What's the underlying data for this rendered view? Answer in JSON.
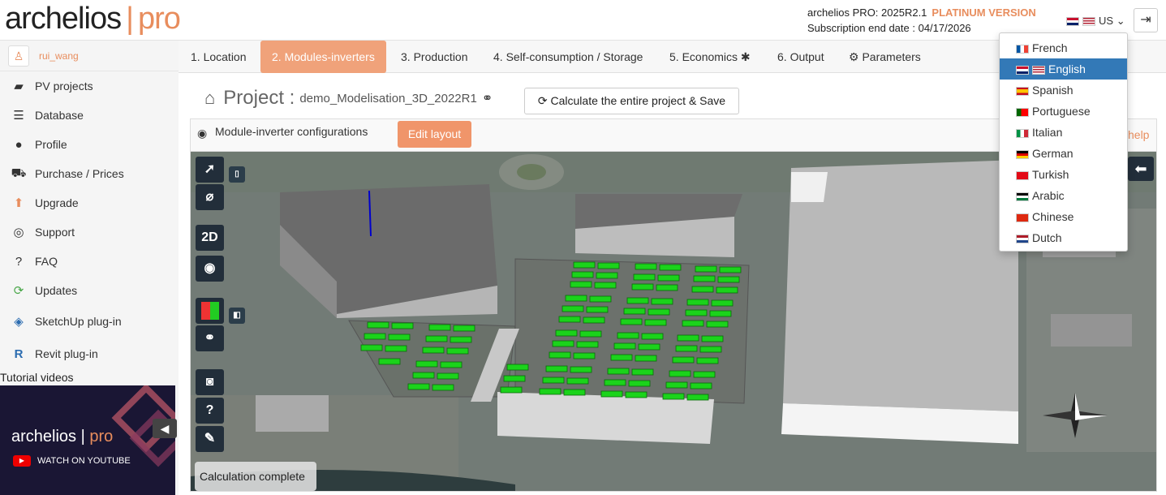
{
  "header": {
    "logo_main": "archelios",
    "logo_sep": "|",
    "logo_pro": "pro",
    "version_text": "archelios PRO: 2025R2.1",
    "edition": "PLATINUM VERSION",
    "subscription": "Subscription end date : 04/17/2026",
    "language_code": "US",
    "logout_icon": "logout-icon"
  },
  "sidebar": {
    "user": "rui_wang",
    "items": [
      {
        "label": "PV projects",
        "icon": "folder-icon"
      },
      {
        "label": "Database",
        "icon": "database-icon"
      },
      {
        "label": "Profile",
        "icon": "user-icon"
      },
      {
        "label": "Purchase / Prices",
        "icon": "cart-icon"
      },
      {
        "label": "Upgrade",
        "icon": "arrow-up-icon"
      },
      {
        "label": "Support",
        "icon": "lifebuoy-icon"
      },
      {
        "label": "FAQ",
        "icon": "question-icon"
      },
      {
        "label": "Updates",
        "icon": "refresh-icon"
      },
      {
        "label": "SketchUp plug-in",
        "icon": "sketchup-icon"
      },
      {
        "label": "Revit plug-in",
        "icon": "revit-icon"
      }
    ],
    "tutorial_label": "Tutorial videos",
    "video_logo_main": "archelios",
    "video_logo_pro": "pro",
    "video_caption": "WATCH ON YOUTUBE"
  },
  "tabs": [
    {
      "label": "1. Location"
    },
    {
      "label": "2. Modules-inverters"
    },
    {
      "label": "3. Production"
    },
    {
      "label": "4. Self-consumption / Storage"
    },
    {
      "label": "5. Economics ✱"
    },
    {
      "label": "6. Output"
    },
    {
      "label": "Parameters"
    }
  ],
  "project": {
    "label": "Project :",
    "name": "demo_Modelisation_3D_2022R1",
    "calc_button": "Calculate the entire project & Save"
  },
  "subbar": {
    "title": "Module-inverter configurations",
    "edit_button": "Edit layout",
    "help": "help"
  },
  "viewport": {
    "tools": [
      "2D"
    ],
    "status": "Calculation complete"
  },
  "languages": {
    "selected": "English",
    "options": [
      "French",
      "English",
      "Spanish",
      "Portuguese",
      "Italian",
      "German",
      "Turkish",
      "Arabic",
      "Chinese",
      "Dutch"
    ]
  },
  "colors": {
    "accent": "#e88d5d",
    "active_tab": "#f0a27a",
    "dropdown_active": "#3379b7",
    "toolbar": "#222e3a"
  }
}
